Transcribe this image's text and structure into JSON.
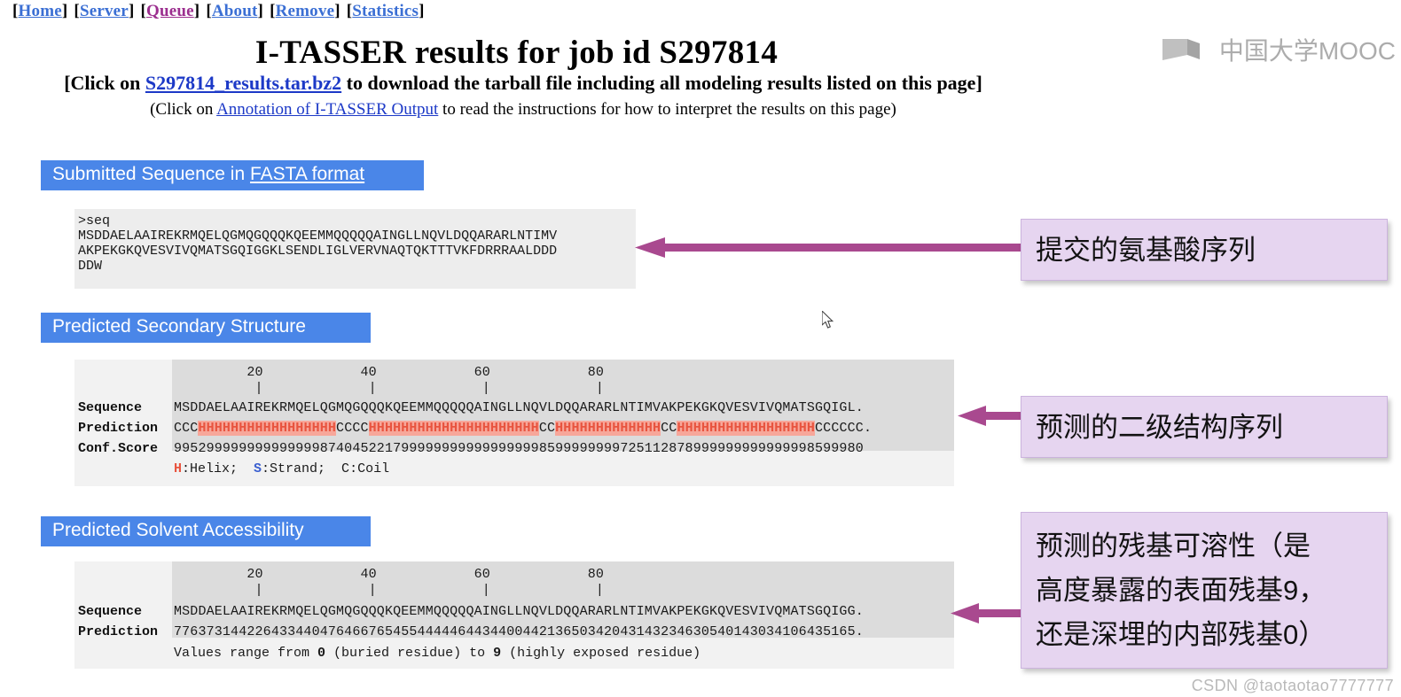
{
  "nav": {
    "items": [
      {
        "label": "Home",
        "visited": false
      },
      {
        "label": "Server",
        "visited": false
      },
      {
        "label": "Queue",
        "visited": true
      },
      {
        "label": "About",
        "visited": false
      },
      {
        "label": "Remove",
        "visited": false
      },
      {
        "label": "Statistics",
        "visited": false
      }
    ]
  },
  "logo": {
    "text": "中国大学MOOC",
    "mark": "book-mark-icon"
  },
  "header": {
    "title": "I-TASSER results for job id S297814",
    "subtitle1_pre": "[Click on ",
    "subtitle1_link": "S297814_results.tar.bz2",
    "subtitle1_post": " to download the tarball file including all modeling results listed on this page]",
    "subtitle2_pre": "(Click on ",
    "subtitle2_link": "Annotation of I-TASSER Output",
    "subtitle2_post": " to read the instructions for how to interpret the results on this page)"
  },
  "sections": {
    "fasta": {
      "header_pre": "Submitted Sequence in ",
      "header_link": "FASTA format",
      "content": ">seq\nMSDDAELAAIREKRMQELQGMQGQQQKQEEMMQQQQQAINGLLNQVLDQQARARLNTIMV\nAKPEKGKQVESVIVQMATSGQIGGKLSENDLIGLVERVNAQTQKTTTVKFDRRRAALDDD\nDDW"
    },
    "secondary_structure": {
      "header": "Predicted Secondary Structure",
      "ruler_numbers": "         20            40            60            80",
      "ruler_ticks": "          |             |             |             |",
      "row_labels": {
        "sequence": "Sequence",
        "prediction": "Prediction",
        "conf": "Conf.Score"
      },
      "sequence": "MSDDAELAAIREKRMQELQGMQGQQQKQEEMMQQQQQAINGLLNQVLDQQARARLNTIMVAKPEKGKQVESVIVQMATSGQIGL.",
      "prediction": "CCCHHHHHHHHHHHHHHHHHCCCCHHHHHHHHHHHHHHHHHHHHHCCHHHHHHHHHHHHHCCHHHHHHHHHHHHHHHHHCCCCCC.",
      "conf_score": "9952999999999999998740452217999999999999999998599999999725112878999999999999998599980",
      "legend_h": "H",
      "legend_h_rest": ":Helix;  ",
      "legend_s": "S",
      "legend_s_rest": ":Strand;  C:Coil"
    },
    "solvent_accessibility": {
      "header": "Predicted Solvent Accessibility",
      "ruler_numbers": "         20            40            60            80",
      "ruler_ticks": "          |             |             |             |",
      "row_labels": {
        "sequence": "Sequence",
        "prediction": "Prediction"
      },
      "sequence": "MSDDAELAAIREKRMQELQGMQGQQQKQEEMMQQQQQAINGLLNQVLDQQARARLNTIMVAKPEKGKQVESVIVQMATSGQIGG.",
      "prediction": "776373144226433440476466765455444446443440044213650342043143234630540143034106435165.",
      "legend_pre": "Values range from ",
      "legend_zero": "0",
      "legend_mid": " (buried residue) to ",
      "legend_nine": "9",
      "legend_post": " (highly exposed residue)"
    }
  },
  "callouts": {
    "c1": "提交的氨基酸序列",
    "c2": "预测的二级结构序列",
    "c3_line1": "预测的残基可溶性（是",
    "c3_line2": "高度暴露的表面残基9，",
    "c3_line3": "还是深埋的内部残基0）"
  },
  "watermark": "CSDN @taotaotao7777777",
  "colors": {
    "accent_blue": "#4a86e8",
    "link_blue": "#1c39c7",
    "nav_link": "#3b6fd4",
    "nav_visited": "#9c2f8f",
    "helix_red": "#e8543f",
    "helix_bg": "#f7a79a",
    "strand_blue": "#3a5fd0",
    "callout_bg": "#e6d5f0",
    "arrow_purple": "#a9498f"
  }
}
